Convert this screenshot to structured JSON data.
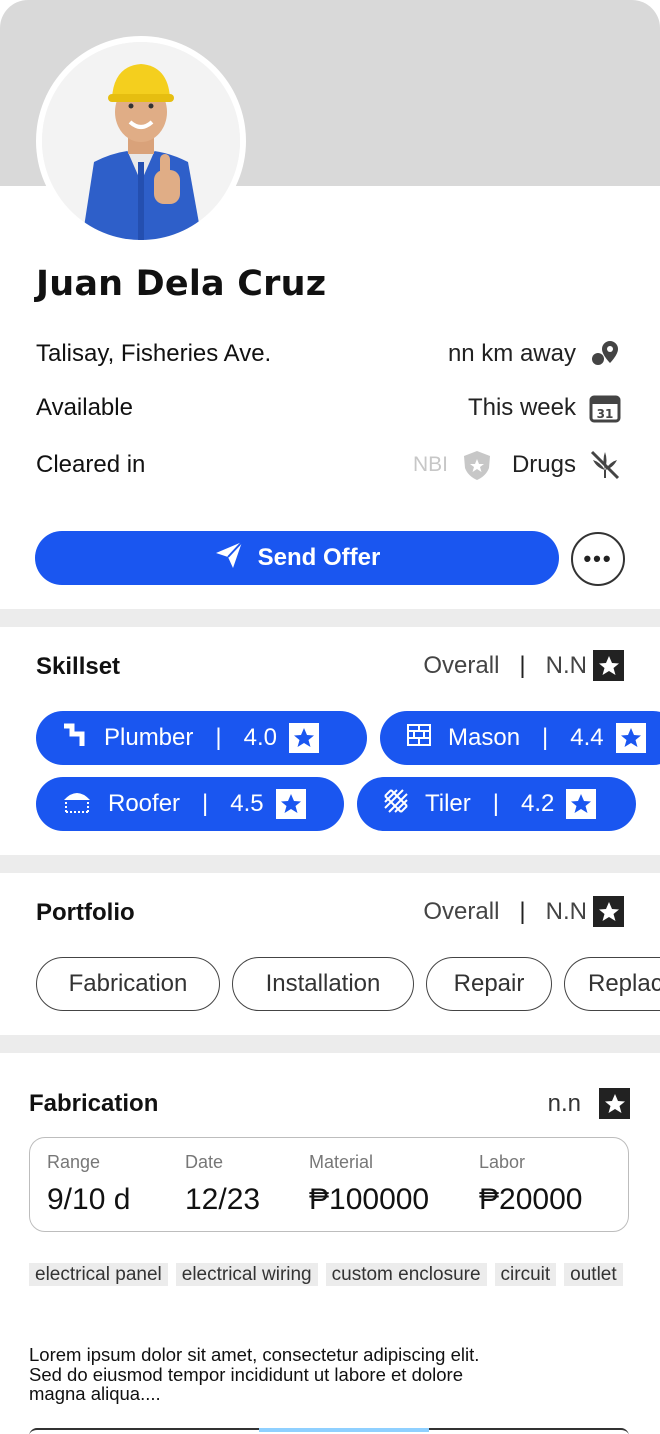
{
  "profile": {
    "name": "Juan Dela Cruz",
    "location": "Talisay, Fisheries Ave.",
    "distance": "nn km away",
    "availability": "Available",
    "availability_value": "This week",
    "cleared_label": "Cleared in",
    "clearance_nbi": "NBI",
    "clearance_drugs": "Drugs"
  },
  "actions": {
    "send_offer": "Send Offer",
    "more": "•••"
  },
  "skillset": {
    "title": "Skillset",
    "overall_label": "Overall",
    "overall_value": "N.N",
    "separator": "|",
    "skills": [
      {
        "name": "Plumber",
        "rating": "4.0",
        "icon": "pipe-icon"
      },
      {
        "name": "Mason",
        "rating": "4.4",
        "icon": "brick-icon"
      },
      {
        "name": "Roofer",
        "rating": "4.5",
        "icon": "roof-icon"
      },
      {
        "name": "Tiler",
        "rating": "4.2",
        "icon": "tile-icon"
      }
    ]
  },
  "portfolio": {
    "title": "Portfolio",
    "overall_label": "Overall",
    "overall_value": "N.N",
    "separator": "|",
    "categories": [
      "Fabrication",
      "Installation",
      "Repair",
      "Replac"
    ]
  },
  "project": {
    "title": "Fabrication",
    "score": "n.n",
    "stats": [
      {
        "label": "Range",
        "value": "9/10 d"
      },
      {
        "label": "Date",
        "value": "12/23"
      },
      {
        "label": "Material",
        "value": "₱100000"
      },
      {
        "label": "Labor",
        "value": "₱20000"
      }
    ],
    "tags": [
      "electrical panel",
      "electrical wiring",
      "custom enclosure",
      "circuit",
      "outlet"
    ],
    "description_line1": "Lorem ipsum dolor sit amet, consectetur adipiscing elit.",
    "description_line2": "Sed do eiusmod tempor incididunt ut labore et dolore",
    "description_line3": "magna aliqua...."
  },
  "colors": {
    "accent": "#1a56f0",
    "banner": "#d9d9d9",
    "divider": "#ececec"
  }
}
